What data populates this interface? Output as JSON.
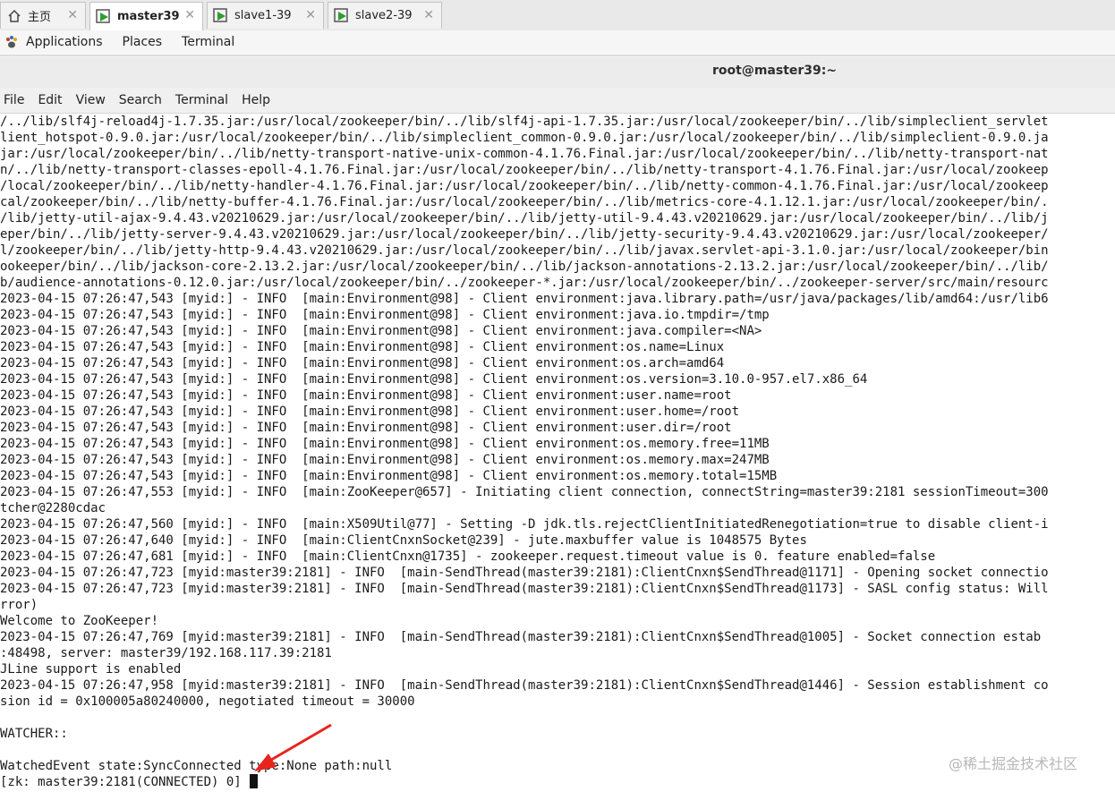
{
  "tabs": [
    {
      "label": "主页",
      "icon": "home-icon"
    },
    {
      "label": "master39",
      "icon": "vm-icon"
    },
    {
      "label": "slave1-39",
      "icon": "vm-icon"
    },
    {
      "label": "slave2-39",
      "icon": "vm-icon"
    }
  ],
  "tab_close": "✕",
  "gnome_bar": {
    "applications": "Applications",
    "places": "Places",
    "terminal": "Terminal"
  },
  "window": {
    "title": "root@master39:~"
  },
  "menu": [
    "File",
    "Edit",
    "View",
    "Search",
    "Terminal",
    "Help"
  ],
  "terminal_lines": [
    "/../lib/slf4j-reload4j-1.7.35.jar:/usr/local/zookeeper/bin/../lib/slf4j-api-1.7.35.jar:/usr/local/zookeeper/bin/../lib/simpleclient_servlet",
    "lient_hotspot-0.9.0.jar:/usr/local/zookeeper/bin/../lib/simpleclient_common-0.9.0.jar:/usr/local/zookeeper/bin/../lib/simpleclient-0.9.0.ja",
    "jar:/usr/local/zookeeper/bin/../lib/netty-transport-native-unix-common-4.1.76.Final.jar:/usr/local/zookeeper/bin/../lib/netty-transport-nat",
    "n/../lib/netty-transport-classes-epoll-4.1.76.Final.jar:/usr/local/zookeeper/bin/../lib/netty-transport-4.1.76.Final.jar:/usr/local/zookeep",
    "/local/zookeeper/bin/../lib/netty-handler-4.1.76.Final.jar:/usr/local/zookeeper/bin/../lib/netty-common-4.1.76.Final.jar:/usr/local/zookeep",
    "cal/zookeeper/bin/../lib/netty-buffer-4.1.76.Final.jar:/usr/local/zookeeper/bin/../lib/metrics-core-4.1.12.1.jar:/usr/local/zookeeper/bin/.",
    "/lib/jetty-util-ajax-9.4.43.v20210629.jar:/usr/local/zookeeper/bin/../lib/jetty-util-9.4.43.v20210629.jar:/usr/local/zookeeper/bin/../lib/j",
    "eper/bin/../lib/jetty-server-9.4.43.v20210629.jar:/usr/local/zookeeper/bin/../lib/jetty-security-9.4.43.v20210629.jar:/usr/local/zookeeper/",
    "l/zookeeper/bin/../lib/jetty-http-9.4.43.v20210629.jar:/usr/local/zookeeper/bin/../lib/javax.servlet-api-3.1.0.jar:/usr/local/zookeeper/bin",
    "ookeeper/bin/../lib/jackson-core-2.13.2.jar:/usr/local/zookeeper/bin/../lib/jackson-annotations-2.13.2.jar:/usr/local/zookeeper/bin/../lib/",
    "b/audience-annotations-0.12.0.jar:/usr/local/zookeeper/bin/../zookeeper-*.jar:/usr/local/zookeeper/bin/../zookeeper-server/src/main/resourc",
    "2023-04-15 07:26:47,543 [myid:] - INFO  [main:Environment@98] - Client environment:java.library.path=/usr/java/packages/lib/amd64:/usr/lib6",
    "2023-04-15 07:26:47,543 [myid:] - INFO  [main:Environment@98] - Client environment:java.io.tmpdir=/tmp",
    "2023-04-15 07:26:47,543 [myid:] - INFO  [main:Environment@98] - Client environment:java.compiler=<NA>",
    "2023-04-15 07:26:47,543 [myid:] - INFO  [main:Environment@98] - Client environment:os.name=Linux",
    "2023-04-15 07:26:47,543 [myid:] - INFO  [main:Environment@98] - Client environment:os.arch=amd64",
    "2023-04-15 07:26:47,543 [myid:] - INFO  [main:Environment@98] - Client environment:os.version=3.10.0-957.el7.x86_64",
    "2023-04-15 07:26:47,543 [myid:] - INFO  [main:Environment@98] - Client environment:user.name=root",
    "2023-04-15 07:26:47,543 [myid:] - INFO  [main:Environment@98] - Client environment:user.home=/root",
    "2023-04-15 07:26:47,543 [myid:] - INFO  [main:Environment@98] - Client environment:user.dir=/root",
    "2023-04-15 07:26:47,543 [myid:] - INFO  [main:Environment@98] - Client environment:os.memory.free=11MB",
    "2023-04-15 07:26:47,543 [myid:] - INFO  [main:Environment@98] - Client environment:os.memory.max=247MB",
    "2023-04-15 07:26:47,543 [myid:] - INFO  [main:Environment@98] - Client environment:os.memory.total=15MB",
    "2023-04-15 07:26:47,553 [myid:] - INFO  [main:ZooKeeper@657] - Initiating client connection, connectString=master39:2181 sessionTimeout=300",
    "tcher@2280cdac",
    "2023-04-15 07:26:47,560 [myid:] - INFO  [main:X509Util@77] - Setting -D jdk.tls.rejectClientInitiatedRenegotiation=true to disable client-i",
    "2023-04-15 07:26:47,640 [myid:] - INFO  [main:ClientCnxnSocket@239] - jute.maxbuffer value is 1048575 Bytes",
    "2023-04-15 07:26:47,681 [myid:] - INFO  [main:ClientCnxn@1735] - zookeeper.request.timeout value is 0. feature enabled=false",
    "2023-04-15 07:26:47,723 [myid:master39:2181] - INFO  [main-SendThread(master39:2181):ClientCnxn$SendThread@1171] - Opening socket connectio",
    "2023-04-15 07:26:47,723 [myid:master39:2181] - INFO  [main-SendThread(master39:2181):ClientCnxn$SendThread@1173] - SASL config status: Will",
    "rror)",
    "Welcome to ZooKeeper!",
    "2023-04-15 07:26:47,769 [myid:master39:2181] - INFO  [main-SendThread(master39:2181):ClientCnxn$SendThread@1005] - Socket connection estab",
    ":48498, server: master39/192.168.117.39:2181",
    "JLine support is enabled",
    "2023-04-15 07:26:47,958 [myid:master39:2181] - INFO  [main-SendThread(master39:2181):ClientCnxn$SendThread@1446] - Session establishment co",
    "sion id = 0x100005a80240000, negotiated timeout = 30000",
    "",
    "WATCHER::",
    "",
    "WatchedEvent state:SyncConnected type:None path:null"
  ],
  "prompt": "[zk: master39:2181(CONNECTED) 0] ",
  "watermark": "@稀土掘金技术社区"
}
